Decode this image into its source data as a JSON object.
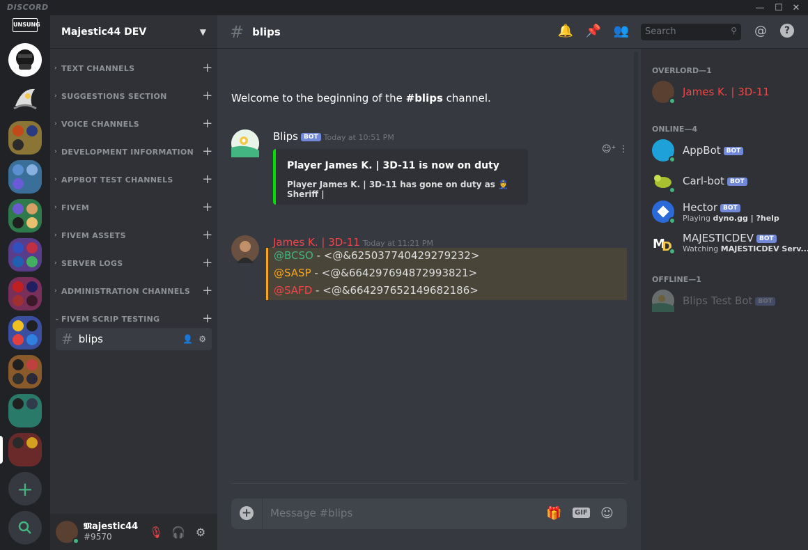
{
  "app": {
    "wordmark": "DISCORD"
  },
  "window_controls": {
    "minimize": "—",
    "maximize": "☐",
    "close": "✕"
  },
  "servers": {
    "add_icon": "+",
    "search_icon": "⚲"
  },
  "guild": {
    "name": "Majestic44 DEV"
  },
  "categories": [
    {
      "label": "TEXT CHANNELS",
      "collapsed": true
    },
    {
      "label": "SUGGESTIONS SECTION",
      "collapsed": true
    },
    {
      "label": "VOICE CHANNELS",
      "collapsed": true
    },
    {
      "label": "DEVELOPMENT INFORMATION",
      "collapsed": true
    },
    {
      "label": "APPBOT TEST CHANNELS",
      "collapsed": true
    },
    {
      "label": "FIVEM",
      "collapsed": true
    },
    {
      "label": "FIVEM ASSETS",
      "collapsed": true
    },
    {
      "label": "SERVER LOGS",
      "collapsed": true
    },
    {
      "label": "ADMINISTRATION CHANNELS",
      "collapsed": true
    },
    {
      "label": "FIVEM SCRIP TESTING",
      "collapsed": false
    }
  ],
  "active_channel": {
    "name": "blips"
  },
  "user_panel": {
    "name": "𝕸ajestic44",
    "tag": "#9570"
  },
  "header": {
    "channel": "blips",
    "search_placeholder": "Search"
  },
  "chat": {
    "welcome_prefix": "Welcome to the beginning of the ",
    "welcome_channel": "#blips",
    "welcome_suffix": " channel.",
    "messages": [
      {
        "author": "Blips",
        "badge": "BOT",
        "timestamp": "Today at 10:51 PM",
        "embed": {
          "title": "Player James K. | 3D-11 is now on duty",
          "description": "Player James K. | 3D-11 has gone on duty as 👮 Sheriff |",
          "color": "#00e000"
        }
      },
      {
        "author": "James K. | 3D-11",
        "author_color": "#f04747",
        "timestamp": "Today at 11:21 PM",
        "lines": [
          {
            "role": "@BCSO",
            "role_color": "#43b581",
            "text": " - <@&625037740429279232>"
          },
          {
            "role": "@SASP",
            "role_color": "#faa61a",
            "text": " - <@&664297694872993821>"
          },
          {
            "role": "@SAFD",
            "role_color": "#f04747",
            "text": " - <@&664297652149682186>"
          }
        ]
      }
    ]
  },
  "composer": {
    "placeholder": "Message #blips",
    "gif_label": "GIF"
  },
  "members": {
    "groups": [
      {
        "label": "OVERLORD—1"
      },
      {
        "label": "ONLINE—4"
      },
      {
        "label": "OFFLINE—1"
      }
    ],
    "list": [
      {
        "name": "James K. | 3D-11",
        "color": "#f04747"
      },
      {
        "name": "AppBot",
        "badge": "BOT"
      },
      {
        "name": "Carl-bot",
        "badge": "BOT"
      },
      {
        "name": "Hector",
        "badge": "BOT",
        "activity_prefix": "Playing ",
        "activity": "dyno.gg | ?help"
      },
      {
        "name": "MAJESTICDEV",
        "badge": "BOT",
        "activity_prefix": "Watching ",
        "activity": "MAJESTICDEV Serv..."
      },
      {
        "name": "Blips Test Bot",
        "badge": "BOT",
        "offline": true
      }
    ]
  }
}
